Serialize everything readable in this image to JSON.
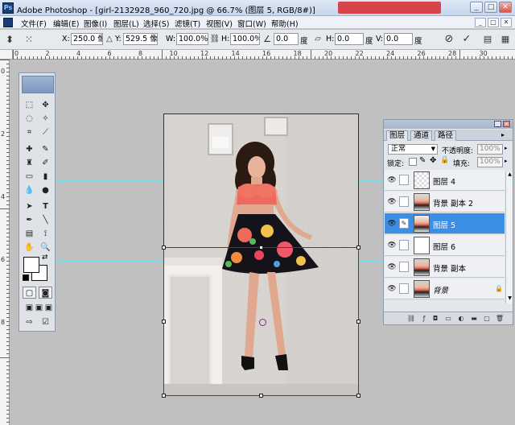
{
  "window": {
    "title": "Adobe Photoshop - [girl-2132928_960_720.jpg @ 66.7% (图层 5, RGB/8#)]",
    "app_badge": "Ps",
    "btn_min": "_",
    "btn_max": "□",
    "btn_close": "✕"
  },
  "menu": {
    "items": [
      "文件(F)",
      "编辑(E)",
      "图像(I)",
      "图层(L)",
      "选择(S)",
      "滤镜(T)",
      "视图(V)",
      "窗口(W)",
      "帮助(H)"
    ],
    "mini_min": "_",
    "mini_max": "□",
    "mini_close": "✕"
  },
  "options": {
    "x_label": "X:",
    "x_value": "250.0 像",
    "y_label": "Y:",
    "y_value": "529.5 像",
    "w_label": "W:",
    "w_value": "100.0%",
    "h_label": "H:",
    "h_value": "100.0%",
    "angle_value": "0.0",
    "angle_unit": "度",
    "hskew_label": "H:",
    "hskew_value": "0.0",
    "hskew_unit": "度",
    "vskew_label": "V:",
    "vskew_value": "0.0",
    "vskew_unit": "度"
  },
  "ruler": {
    "h_marks": [
      "0",
      "2",
      "4",
      "6",
      "8",
      "10",
      "12",
      "14",
      "16",
      "18",
      "20",
      "22",
      "24",
      "26",
      "28",
      "30"
    ],
    "v_marks": [
      "0",
      "2",
      "4",
      "6",
      "8"
    ]
  },
  "layers_panel": {
    "tabs": [
      "图层",
      "通道",
      "路径"
    ],
    "blend_mode": "正常",
    "opacity_label": "不透明度:",
    "opacity_value": "100%",
    "lock_label": "锁定:",
    "fill_label": "填充:",
    "fill_value": "100%",
    "layers": [
      {
        "name": "图层 4",
        "visible": true,
        "selected": false,
        "locked": false
      },
      {
        "name": "背景 副本 2",
        "visible": true,
        "selected": false,
        "locked": false
      },
      {
        "name": "图层 5",
        "visible": true,
        "selected": true,
        "locked": false
      },
      {
        "name": "图层 6",
        "visible": true,
        "selected": false,
        "locked": false
      },
      {
        "name": "背景 副本",
        "visible": true,
        "selected": false,
        "locked": false
      },
      {
        "name": "背景",
        "visible": true,
        "selected": false,
        "locked": true
      }
    ]
  },
  "colors": {
    "selection_blue": "#3d8fe6",
    "guide_cyan": "#72e0e8",
    "workspace_gray": "#c0c0c0",
    "top_coral": "#ef6a5c"
  }
}
